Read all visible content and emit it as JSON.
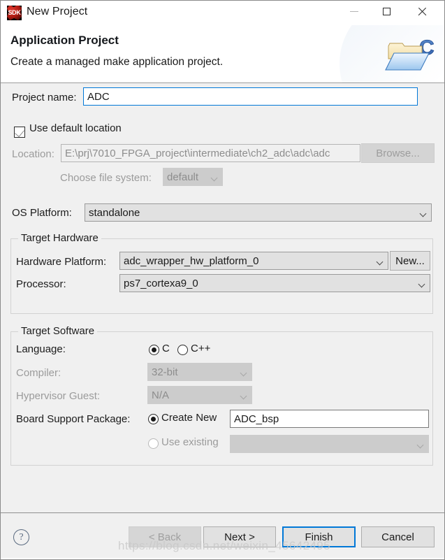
{
  "window": {
    "title": "New Project",
    "app_icon_text": "SDK",
    "controls": {
      "minimize": "minimize-icon",
      "maximize": "maximize-icon",
      "close": "close-icon"
    }
  },
  "banner": {
    "heading": "Application Project",
    "description": "Create a managed make application project.",
    "icon": "folder-c-icon"
  },
  "form": {
    "project_name_label": "Project name:",
    "project_name_value": "ADC",
    "use_default_location_label": "Use default location",
    "use_default_location_checked": true,
    "location_label": "Location:",
    "location_value": "E:\\prj\\7010_FPGA_project\\intermediate\\ch2_adc\\adc\\adc",
    "browse_label": "Browse...",
    "choose_file_system_label": "Choose file system:",
    "choose_file_system_value": "default",
    "os_platform_label": "OS Platform:",
    "os_platform_value": "standalone"
  },
  "target_hardware": {
    "group_title": "Target Hardware",
    "hardware_platform_label": "Hardware Platform:",
    "hardware_platform_value": "adc_wrapper_hw_platform_0",
    "new_button_label": "New...",
    "processor_label": "Processor:",
    "processor_value": "ps7_cortexa9_0"
  },
  "target_software": {
    "group_title": "Target Software",
    "language_label": "Language:",
    "language_options": [
      "C",
      "C++"
    ],
    "language_selected": "C",
    "compiler_label": "Compiler:",
    "compiler_value": "32-bit",
    "hypervisor_guest_label": "Hypervisor Guest:",
    "hypervisor_guest_value": "N/A",
    "bsp_label": "Board Support Package:",
    "bsp_create_new_label": "Create New",
    "bsp_create_new_value": "ADC_bsp",
    "bsp_use_existing_label": "Use existing",
    "bsp_use_existing_value": "",
    "bsp_selected": "Create New"
  },
  "footer": {
    "help_glyph": "?",
    "back_label": "< Back",
    "next_label": "Next >",
    "finish_label": "Finish",
    "cancel_label": "Cancel"
  },
  "watermark": {
    "text": "https://blog.csdn.net/weixin_45642495"
  },
  "colors": {
    "accent": "#0078d7",
    "dialog_bg": "#f0f0f0",
    "titlebar_bg": "#ffffff",
    "disabled_text": "#9b9b9b"
  }
}
